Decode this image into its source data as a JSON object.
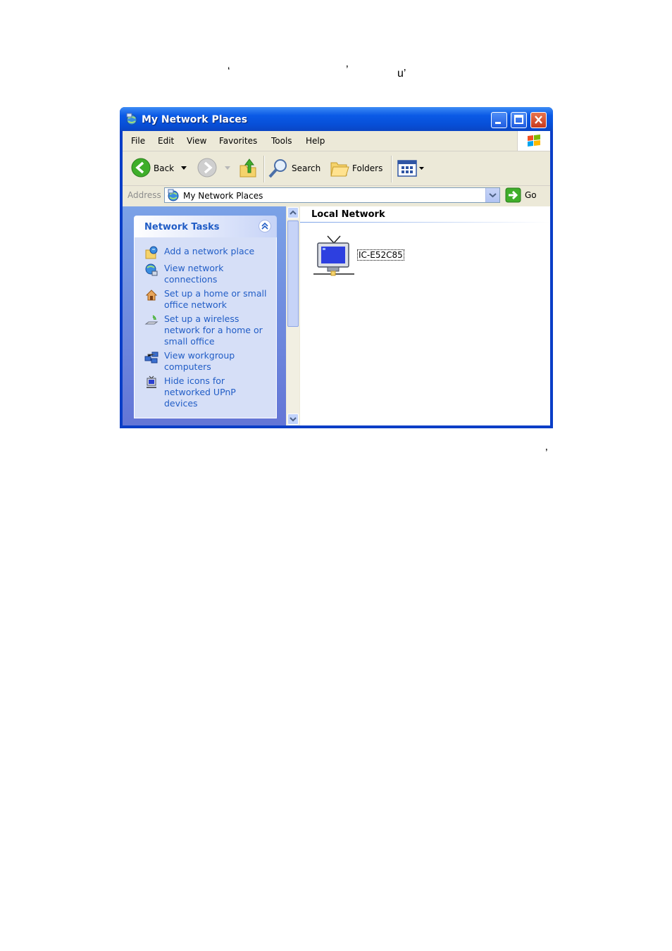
{
  "stray_marks": {
    "a": "‘",
    "b": "’",
    "c": "u’",
    "d": "’"
  },
  "window": {
    "title": "My Network Places"
  },
  "menu": {
    "file": "File",
    "edit": "Edit",
    "view": "View",
    "favorites": "Favorites",
    "tools": "Tools",
    "help": "Help"
  },
  "toolbar": {
    "back": "Back",
    "search": "Search",
    "folders": "Folders"
  },
  "address": {
    "label": "Address",
    "value": "My Network Places",
    "go": "Go"
  },
  "tasks": {
    "title": "Network Tasks",
    "items": [
      {
        "label": "Add a network place",
        "icon": "add-network-place-icon"
      },
      {
        "label": "View network connections",
        "icon": "network-connections-icon"
      },
      {
        "label": "Set up a home or small office network",
        "icon": "home-network-icon"
      },
      {
        "label": "Set up a wireless network for a home or small office",
        "icon": "wireless-network-icon"
      },
      {
        "label": "View workgroup computers",
        "icon": "workgroup-icon"
      },
      {
        "label": "Hide icons for networked UPnP devices",
        "icon": "upnp-devices-icon"
      }
    ]
  },
  "content": {
    "group_title": "Local Network",
    "device": {
      "label": "IC-E52C85",
      "icon": "network-tv-device-icon"
    }
  },
  "colors": {
    "titlebar": "#0b5ae6",
    "task_link": "#215dc6",
    "taskpane": "#7ba2e7"
  }
}
